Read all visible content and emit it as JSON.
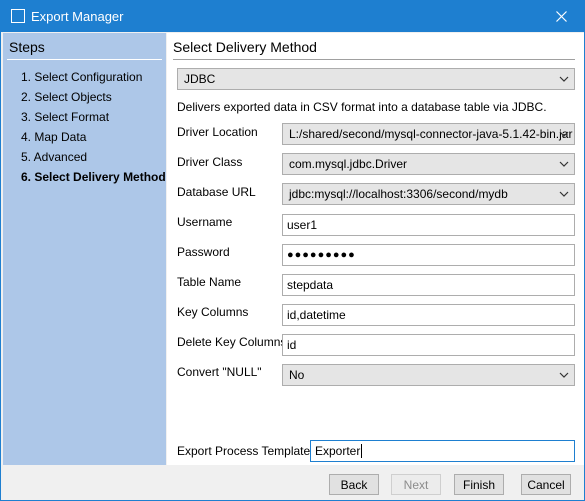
{
  "window": {
    "title": "Export Manager"
  },
  "sidebar": {
    "heading": "Steps",
    "items": [
      {
        "label": "1. Select Configuration"
      },
      {
        "label": "2. Select Objects"
      },
      {
        "label": "3. Select Format"
      },
      {
        "label": "4. Map Data"
      },
      {
        "label": "5. Advanced"
      },
      {
        "label": "6. Select Delivery Method"
      }
    ]
  },
  "main": {
    "heading": "Select Delivery Method",
    "method": "JDBC",
    "description": "Delivers exported data in CSV format into a database table via JDBC.",
    "fields": {
      "driver_location": {
        "label": "Driver Location",
        "value": "L:/shared/second/mysql-connector-java-5.1.42-bin.jar"
      },
      "driver_class": {
        "label": "Driver Class",
        "value": "com.mysql.jdbc.Driver"
      },
      "database_url": {
        "label": "Database URL",
        "value": "jdbc:mysql://localhost:3306/second/mydb"
      },
      "username": {
        "label": "Username",
        "value": "user1"
      },
      "password": {
        "label": "Password",
        "value": "●●●●●●●●●"
      },
      "table_name": {
        "label": "Table Name",
        "value": "stepdata"
      },
      "key_columns": {
        "label": "Key Columns",
        "value": "id,datetime"
      },
      "delete_key_columns": {
        "label": "Delete Key Columns",
        "value": "id"
      },
      "convert_null": {
        "label": "Convert \"NULL\"",
        "value": "No"
      }
    },
    "template": {
      "label": "Export Process Template:",
      "value": "Exporter"
    }
  },
  "buttons": {
    "back": "Back",
    "next": "Next",
    "finish": "Finish",
    "cancel": "Cancel"
  }
}
